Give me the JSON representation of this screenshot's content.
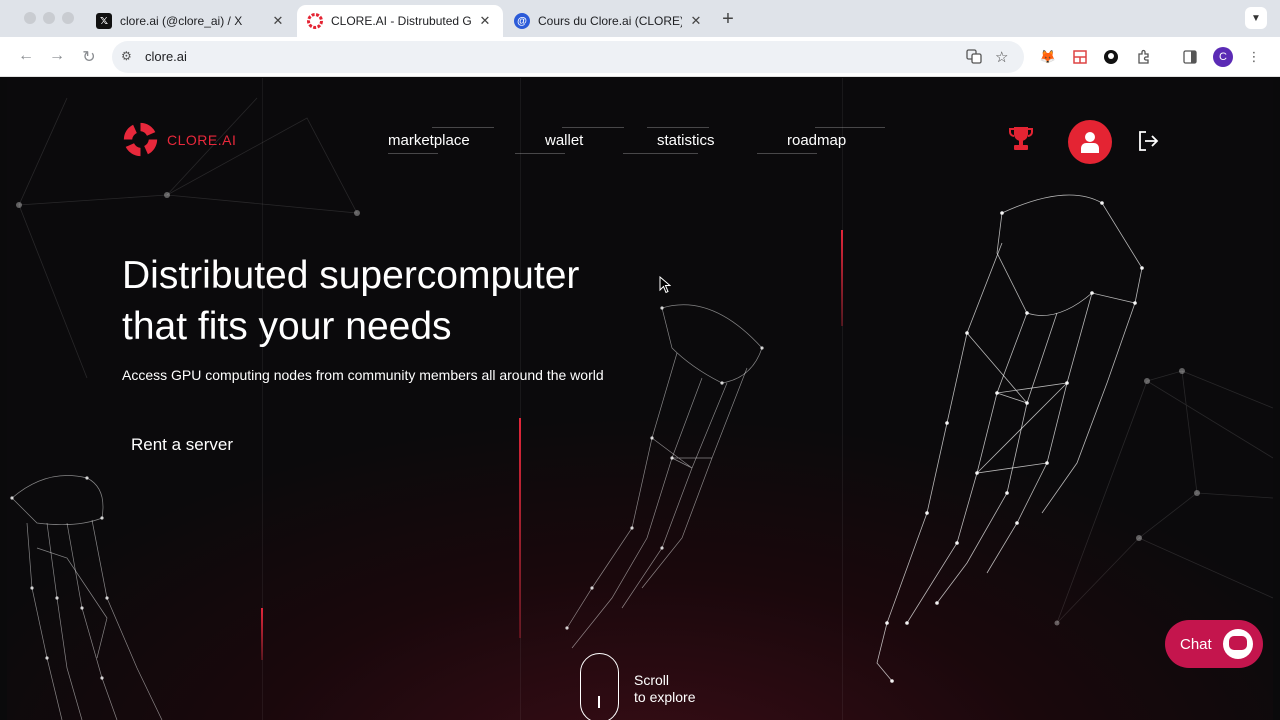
{
  "browser": {
    "tabs": [
      {
        "title": "clore.ai (@clore_ai) / X",
        "favicon": "x-logo",
        "active": false
      },
      {
        "title": "CLORE.AI - Distrubuted GPU",
        "favicon": "clore-logo",
        "active": true
      },
      {
        "title": "Cours du Clore.ai (CLORE), G",
        "favicon": "coingecko-logo",
        "active": false
      }
    ],
    "new_tab_label": "+",
    "address": "clore.ai",
    "profile_initial": "C"
  },
  "site": {
    "logo_text": "CLORE.AI",
    "nav": [
      "marketplace",
      "wallet",
      "statistics",
      "roadmap"
    ],
    "hero": {
      "title_line1": "Distributed supercomputer",
      "title_line2": "that fits your needs",
      "subtitle": "Access GPU computing nodes from community members all around the world",
      "cta": "Rent a server"
    },
    "scroll": {
      "line1": "Scroll",
      "line2": "to explore"
    },
    "chat_label": "Chat"
  },
  "colors": {
    "accent": "#e42433",
    "chat": "#c4154d",
    "background": "#0a0a0b"
  }
}
